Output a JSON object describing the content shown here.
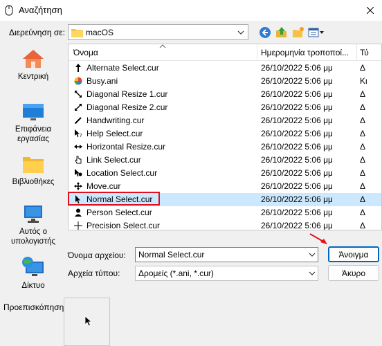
{
  "window": {
    "title": "Αναζήτηση"
  },
  "lookin": {
    "label": "Διερεύνηση σε:",
    "value": "macOS"
  },
  "places": [
    {
      "label": "Κεντρική"
    },
    {
      "label": "Επιφάνεια εργασίας"
    },
    {
      "label": "Βιβλιοθήκες"
    },
    {
      "label": "Αυτός ο υπολογιστής"
    },
    {
      "label": "Δίκτυο"
    }
  ],
  "columns": {
    "name": "Όνομα",
    "date": "Ημερομηνία τροποποί...",
    "type": "Τύ"
  },
  "files": [
    {
      "name": "Alternate Select.cur",
      "date": "26/10/2022 5:06 μμ",
      "type": "Δ",
      "icon": "arrow-up-icon"
    },
    {
      "name": "Busy.ani",
      "date": "26/10/2022 5:06 μμ",
      "type": "Κι",
      "icon": "busy-wheel-icon"
    },
    {
      "name": "Diagonal Resize 1.cur",
      "date": "26/10/2022 5:06 μμ",
      "type": "Δ",
      "icon": "diagonal-resize-1-icon"
    },
    {
      "name": "Diagonal Resize 2.cur",
      "date": "26/10/2022 5:06 μμ",
      "type": "Δ",
      "icon": "diagonal-resize-2-icon"
    },
    {
      "name": "Handwriting.cur",
      "date": "26/10/2022 5:06 μμ",
      "type": "Δ",
      "icon": "pen-icon"
    },
    {
      "name": "Help Select.cur",
      "date": "26/10/2022 5:06 μμ",
      "type": "Δ",
      "icon": "help-icon"
    },
    {
      "name": "Horizontal Resize.cur",
      "date": "26/10/2022 5:06 μμ",
      "type": "Δ",
      "icon": "horizontal-resize-icon"
    },
    {
      "name": "Link Select.cur",
      "date": "26/10/2022 5:06 μμ",
      "type": "Δ",
      "icon": "hand-icon"
    },
    {
      "name": "Location Select.cur",
      "date": "26/10/2022 5:06 μμ",
      "type": "Δ",
      "icon": "location-pin-icon"
    },
    {
      "name": "Move.cur",
      "date": "26/10/2022 5:06 μμ",
      "type": "Δ",
      "icon": "move-icon"
    },
    {
      "name": "Normal Select.cur",
      "date": "26/10/2022 5:06 μμ",
      "type": "Δ",
      "icon": "pointer-icon",
      "selected": true
    },
    {
      "name": "Person Select.cur",
      "date": "26/10/2022 5:06 μμ",
      "type": "Δ",
      "icon": "person-icon"
    },
    {
      "name": "Precision Select.cur",
      "date": "26/10/2022 5:06 μμ",
      "type": "Δ",
      "icon": "crosshair-icon"
    }
  ],
  "filename": {
    "label": "Όνομα αρχείου:",
    "value": "Normal Select.cur"
  },
  "filetype": {
    "label": "Αρχεία τύπου:",
    "value": "Δρομείς (*.ani, *.cur)"
  },
  "buttons": {
    "open": "Άνοιγμα",
    "cancel": "Άκυρο"
  },
  "preview": {
    "label": "Προεπισκόπηση:"
  },
  "colors": {
    "selection": "#cce8ff",
    "highlight": "#e0101c",
    "accent": "#0067c0"
  }
}
